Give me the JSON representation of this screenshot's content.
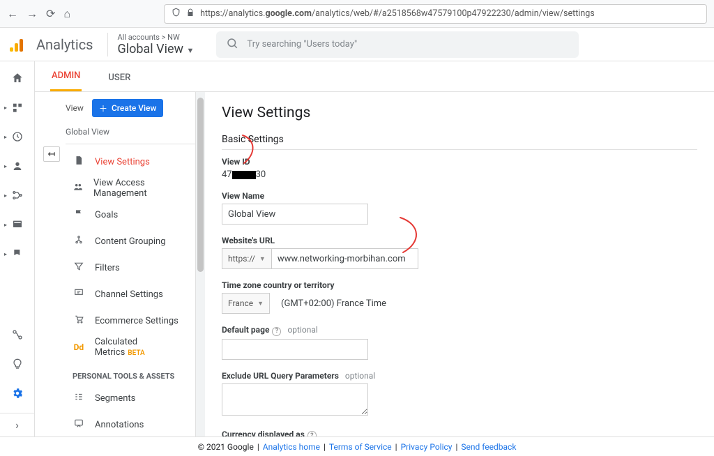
{
  "browser": {
    "url": "https://analytics.google.com/analytics/web/#/a2518568w47579100p47922230/admin/view/settings",
    "host": "google.com"
  },
  "header": {
    "brand": "Analytics",
    "crumb": "All accounts > NW",
    "view_title": "Global View",
    "search_placeholder": "Try searching \"Users today\""
  },
  "tabs": {
    "admin": "ADMIN",
    "user": "USER"
  },
  "view_column": {
    "label": "View",
    "create_label": "Create View",
    "current_view": "Global View",
    "section_personal": "PERSONAL TOOLS & ASSETS",
    "items": [
      "View Settings",
      "View Access Management",
      "Goals",
      "Content Grouping",
      "Filters",
      "Channel Settings",
      "Ecommerce Settings",
      "Calculated Metrics"
    ],
    "beta": "BETA",
    "personal_items": [
      "Segments",
      "Annotations"
    ]
  },
  "panel": {
    "title": "View Settings",
    "group_basic": "Basic Settings",
    "labels": {
      "view_id": "View ID",
      "view_name": "View Name",
      "website_url": "Website's URL",
      "timezone": "Time zone country or territory",
      "default_page": "Default page",
      "exclude": "Exclude URL Query Parameters",
      "currency": "Currency displayed as",
      "optional": "optional"
    },
    "values": {
      "view_id_prefix": "47",
      "view_id_suffix": "30",
      "view_name": "Global View",
      "protocol": "https://",
      "url": "www.networking-morbihan.com",
      "tz_country": "France",
      "tz_offset": "(GMT+02:00) France Time"
    }
  },
  "footer": {
    "copyright": "© 2021 Google",
    "links": [
      "Analytics home",
      "Terms of Service",
      "Privacy Policy",
      "Send feedback"
    ]
  }
}
